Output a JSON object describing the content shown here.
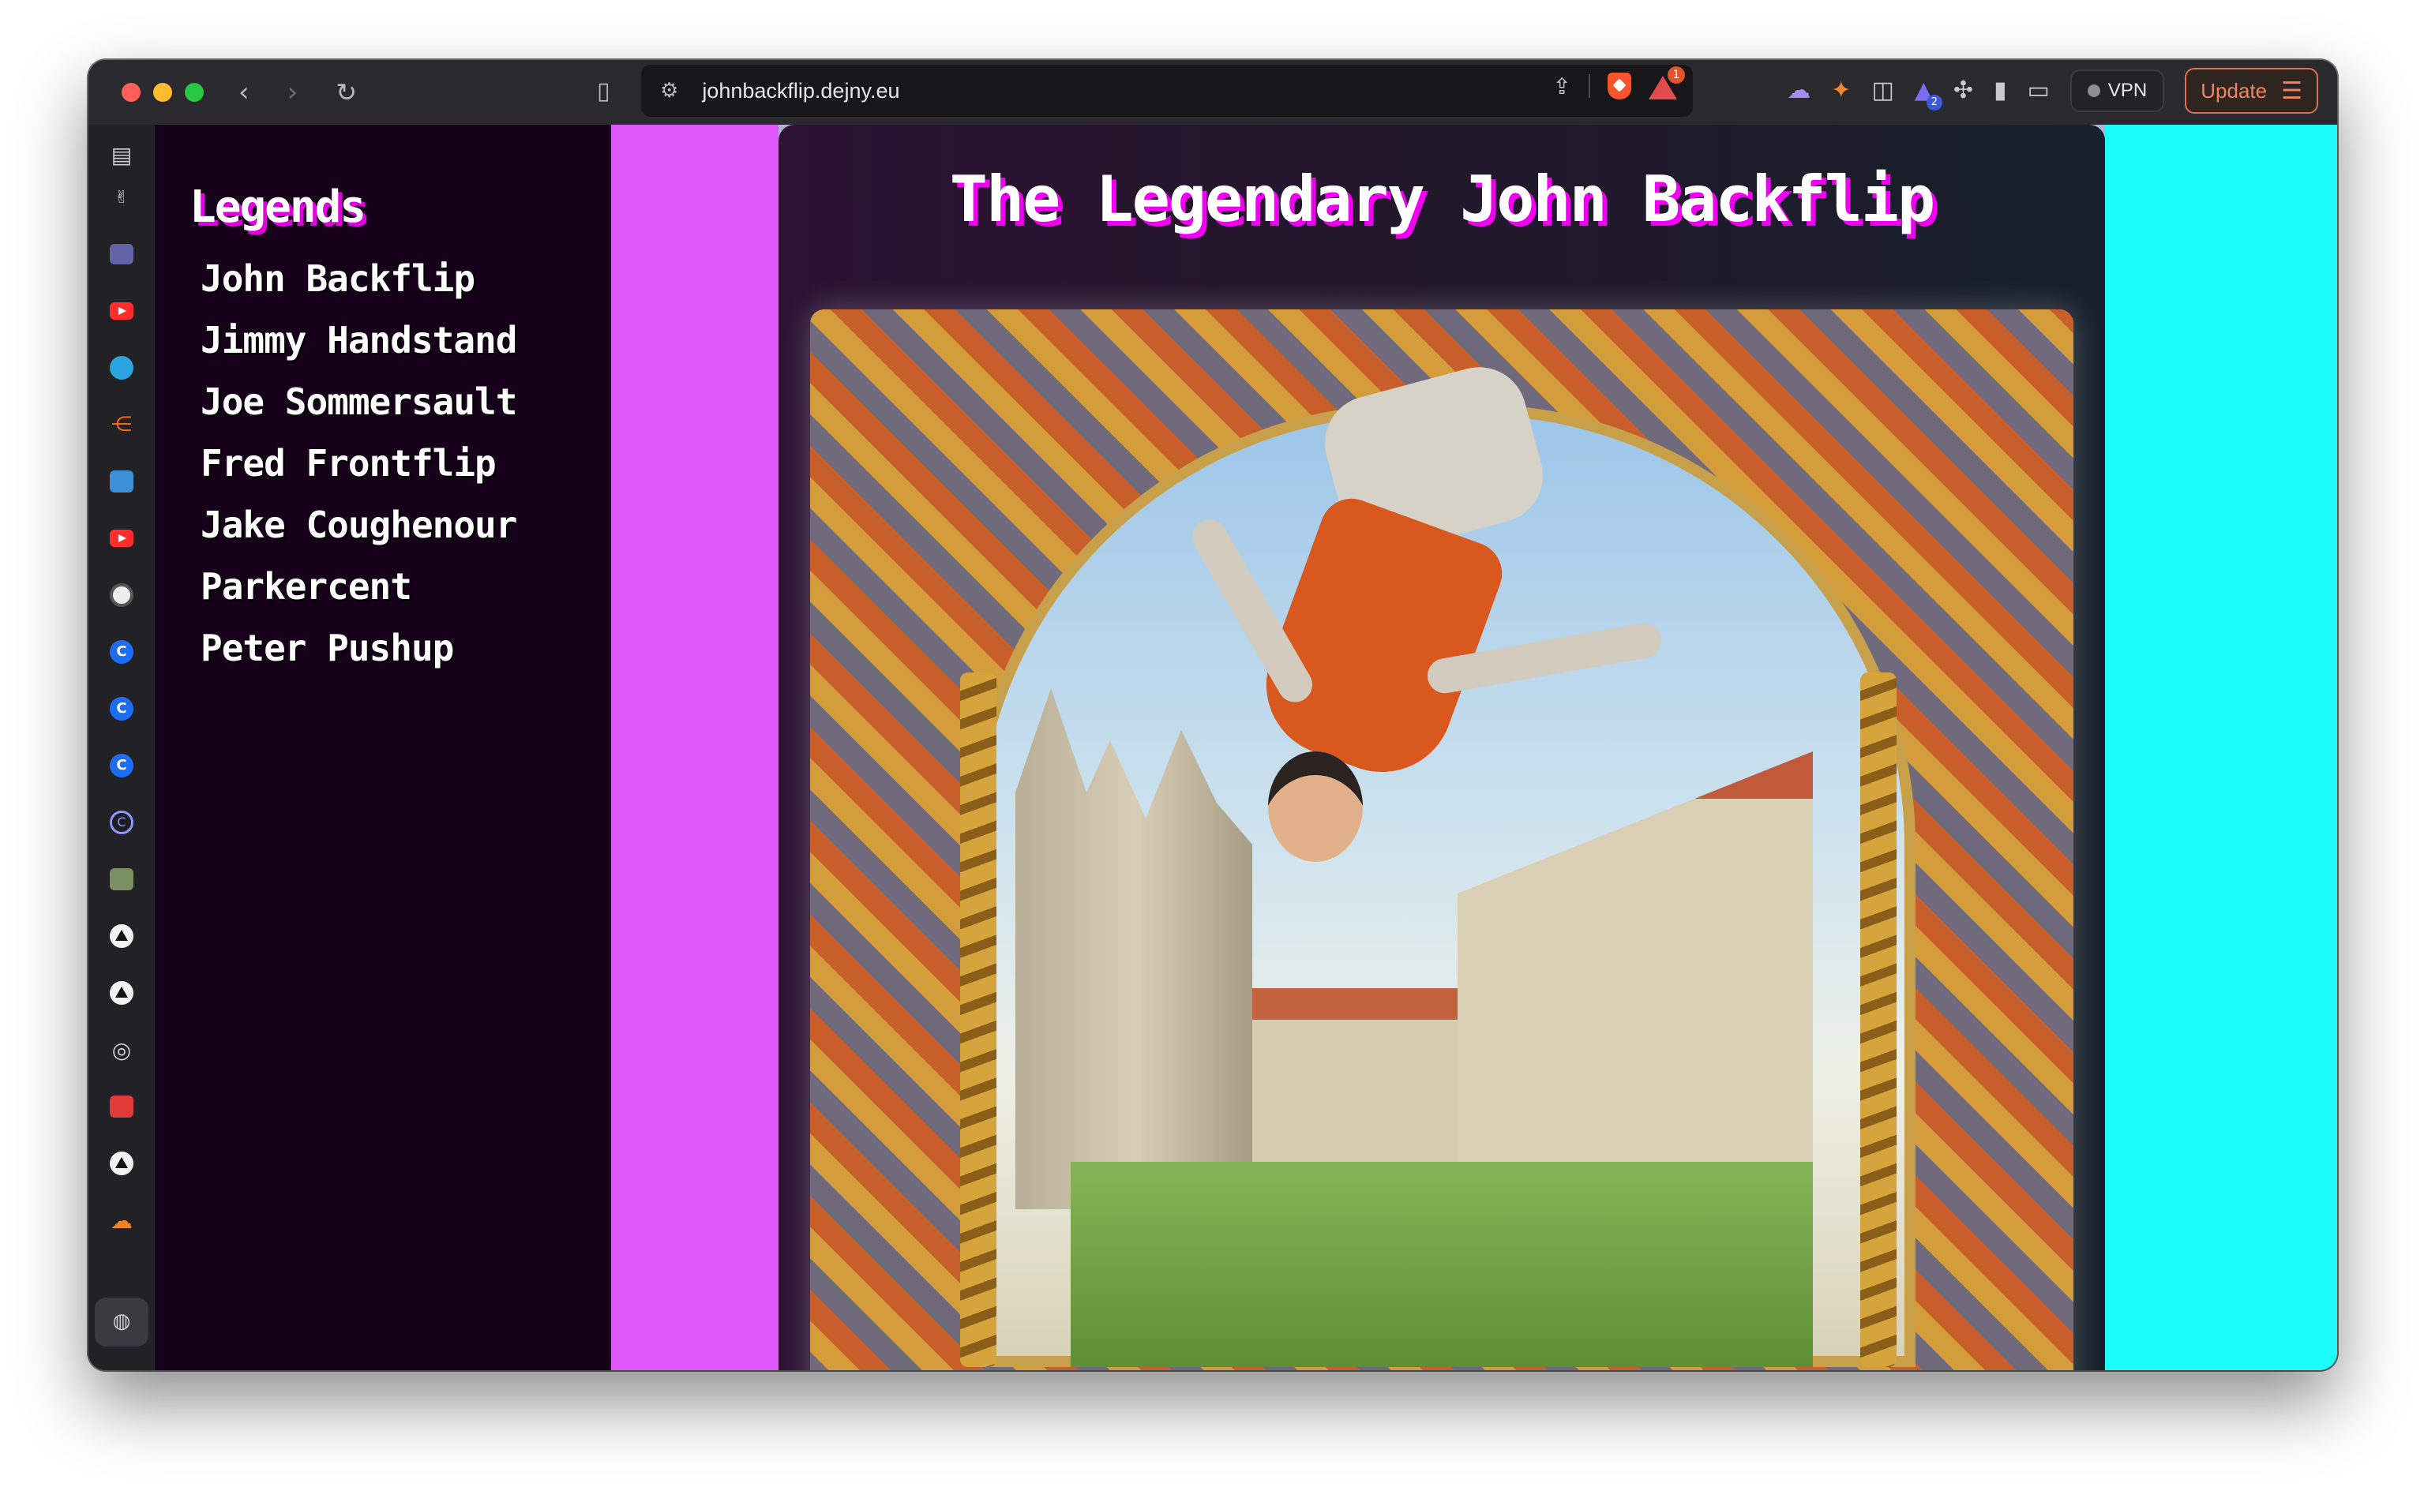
{
  "browser": {
    "url": "johnbackflip.dejny.eu",
    "vpn_label": "VPN",
    "update_label": "Update",
    "rewards_badge": "1",
    "extension_badge": "2",
    "sidebar_icons": [
      "sidebar-toggle-icon",
      "teams-icon",
      "youtube-icon",
      "telegram-icon",
      "streaming-icon",
      "contacts-icon",
      "youtube-icon",
      "openai-icon",
      "c-app-icon",
      "c-app-icon",
      "c-app-icon",
      "copilot-icon",
      "photo-icon",
      "vercel-icon",
      "vercel-icon",
      "github-icon",
      "warning-app-icon",
      "vercel-icon",
      "cloud-icon",
      "globe-icon",
      "add-icon"
    ]
  },
  "page": {
    "sidebar_heading": "Legends",
    "legends": [
      "John Backflip",
      "Jimmy Handstand",
      "Joe Sommersault",
      "Fred Frontflip",
      "Jake Coughenour",
      "Parkercent",
      "Peter Pushup"
    ],
    "title": "The Legendary John Backflip",
    "colors": {
      "magenta_band": "#dd57fb",
      "cyan_band": "#1bfcfb",
      "sidebar_bg": "#16001a",
      "title_shadow": "#f000f0"
    }
  }
}
